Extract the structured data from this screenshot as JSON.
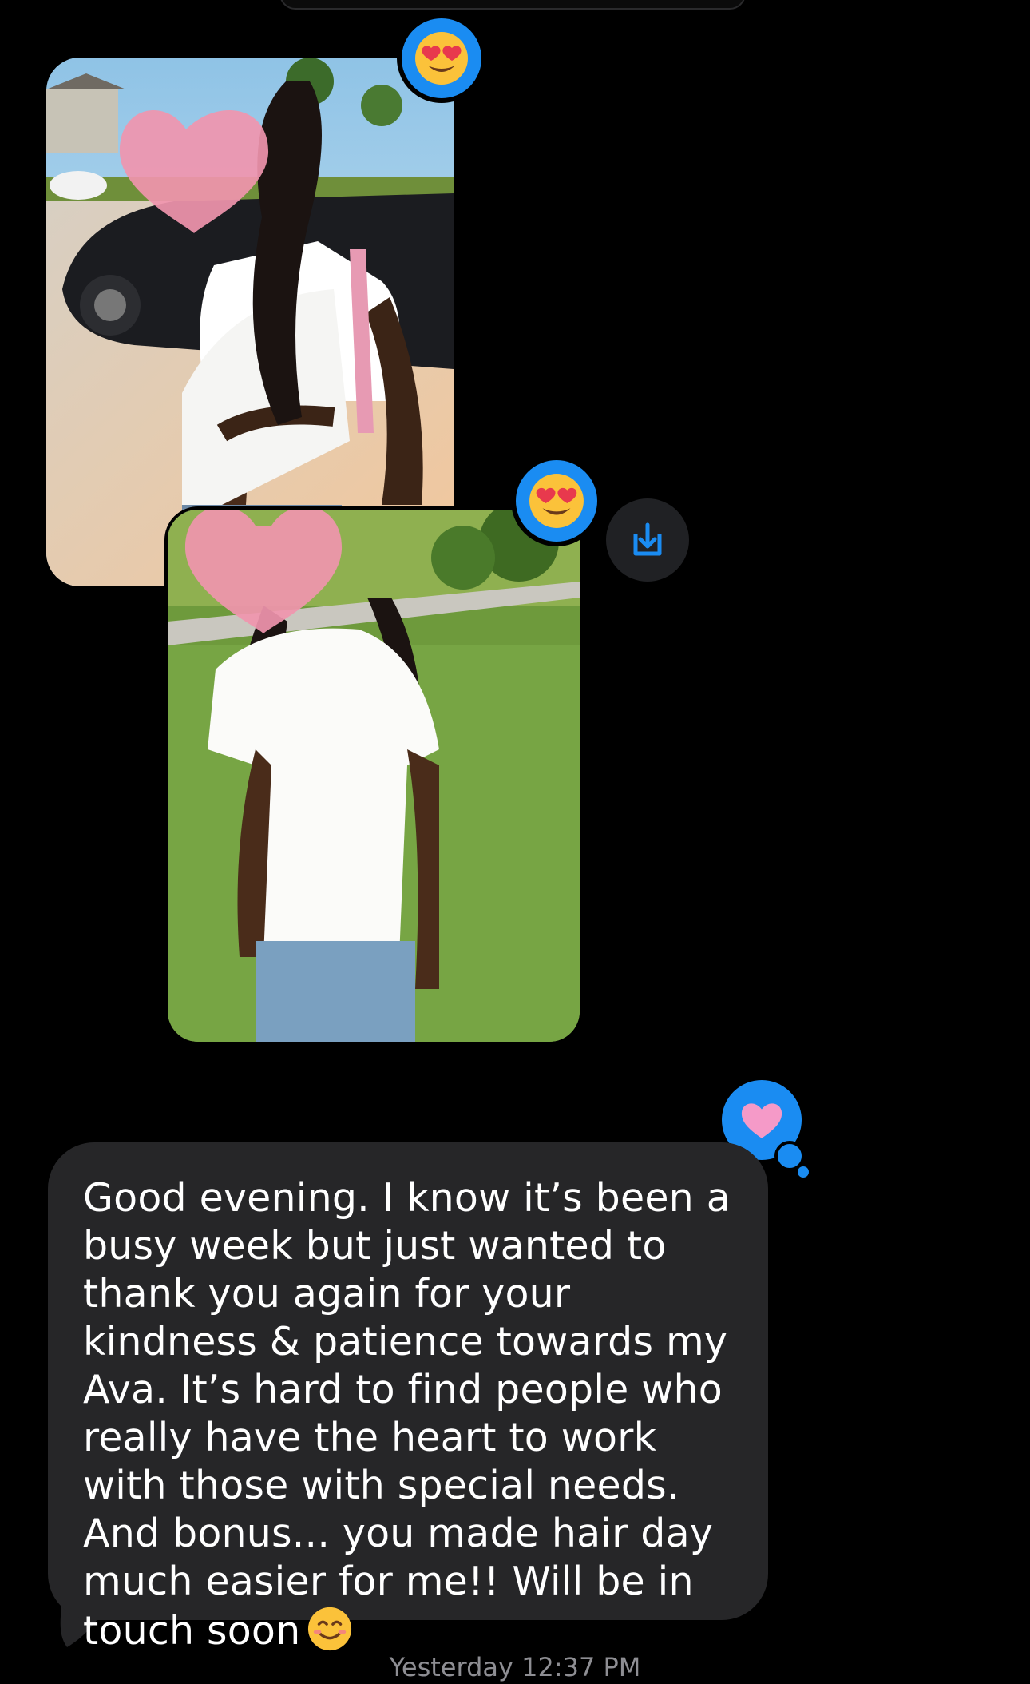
{
  "conversation": {
    "photos": [
      {
        "name": "photo-1",
        "reaction_icon": "heart-eyes-emoji-icon"
      },
      {
        "name": "photo-2",
        "reaction_icon": "heart-eyes-emoji-icon"
      }
    ],
    "save_icon": "save-to-photos-icon",
    "message": {
      "text": "Good evening. I know it’s been a busy week but just wanted to thank you again for your kindness & patience towards my Ava. It’s hard to find people who really have the heart to work with those with special needs. And bonus... you made hair day much easier for me!! Will be in touch soon",
      "trailing_emoji": "smiling-face-icon",
      "reaction_icon": "pink-heart-icon"
    },
    "timestamp": "Yesterday 12:37 PM"
  },
  "colors": {
    "background": "#000000",
    "bubble": "#262628",
    "tapback": "#1a8cf2",
    "text": "#ffffff",
    "timestamp": "#8e8e93"
  }
}
